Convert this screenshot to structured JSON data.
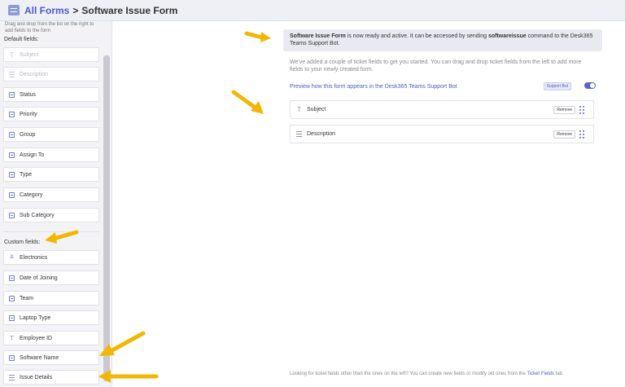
{
  "header": {
    "breadcrumb_link": "All Forms",
    "separator": ">",
    "current": "Software Issue Form"
  },
  "sidebar": {
    "hint": "Drag and drop from the list on the right to add fields to the form",
    "default_label": "Default fields:",
    "default_fields": [
      {
        "label": "Subject",
        "icon": "text-icon",
        "disabled": true
      },
      {
        "label": "Description",
        "icon": "paragraph-icon",
        "disabled": true
      },
      {
        "label": "Status",
        "icon": "dropdown-icon",
        "disabled": false
      },
      {
        "label": "Priority",
        "icon": "dropdown-icon",
        "disabled": false
      },
      {
        "label": "Group",
        "icon": "dropdown-icon",
        "disabled": false
      },
      {
        "label": "Assign To",
        "icon": "dropdown-icon",
        "disabled": false
      },
      {
        "label": "Type",
        "icon": "dropdown-icon",
        "disabled": false
      },
      {
        "label": "Category",
        "icon": "dropdown-icon",
        "disabled": false
      },
      {
        "label": "Sub Category",
        "icon": "dropdown-icon",
        "disabled": false
      }
    ],
    "custom_label": "Custom fields:",
    "custom_fields": [
      {
        "label": "Electronics",
        "icon": "chevrons-icon"
      },
      {
        "label": "Date of Joining",
        "icon": "calendar-icon"
      },
      {
        "label": "Team",
        "icon": "dropdown-icon"
      },
      {
        "label": "Laptop Type",
        "icon": "dropdown-icon"
      },
      {
        "label": "Employee ID",
        "icon": "text-icon"
      },
      {
        "label": "Software Name",
        "icon": "dropdown-icon"
      },
      {
        "label": "Issue Details",
        "icon": "paragraph-icon"
      }
    ]
  },
  "main": {
    "banner": {
      "form_name": "Software Issue Form",
      "text_1": " is now ready and active. It can be accessed by sending ",
      "command": "softwareissue",
      "text_2": " command to the Desk365 Teams Support Bot."
    },
    "intro": "We've added a couple of ticket fields to get you started. You can drag and drop ticket fields from the left to add more fields to your newly created form.",
    "preview_link": "Preview how this form appears in the Desk365 Teams Support Bot",
    "bot_badge": "Support Bot",
    "form_fields": [
      {
        "label": "Subject",
        "icon": "text-icon",
        "remove": "Remove"
      },
      {
        "label": "Description",
        "icon": "paragraph-icon",
        "remove": "Remove"
      }
    ],
    "footer": {
      "text": "Looking for ticket fields other than the ones on the left? You can create new fields or modify old ones from the ",
      "link": "Ticket Fields",
      "suffix": " tab."
    }
  },
  "colors": {
    "accent": "#5059c9",
    "arrow": "#f2b705"
  }
}
